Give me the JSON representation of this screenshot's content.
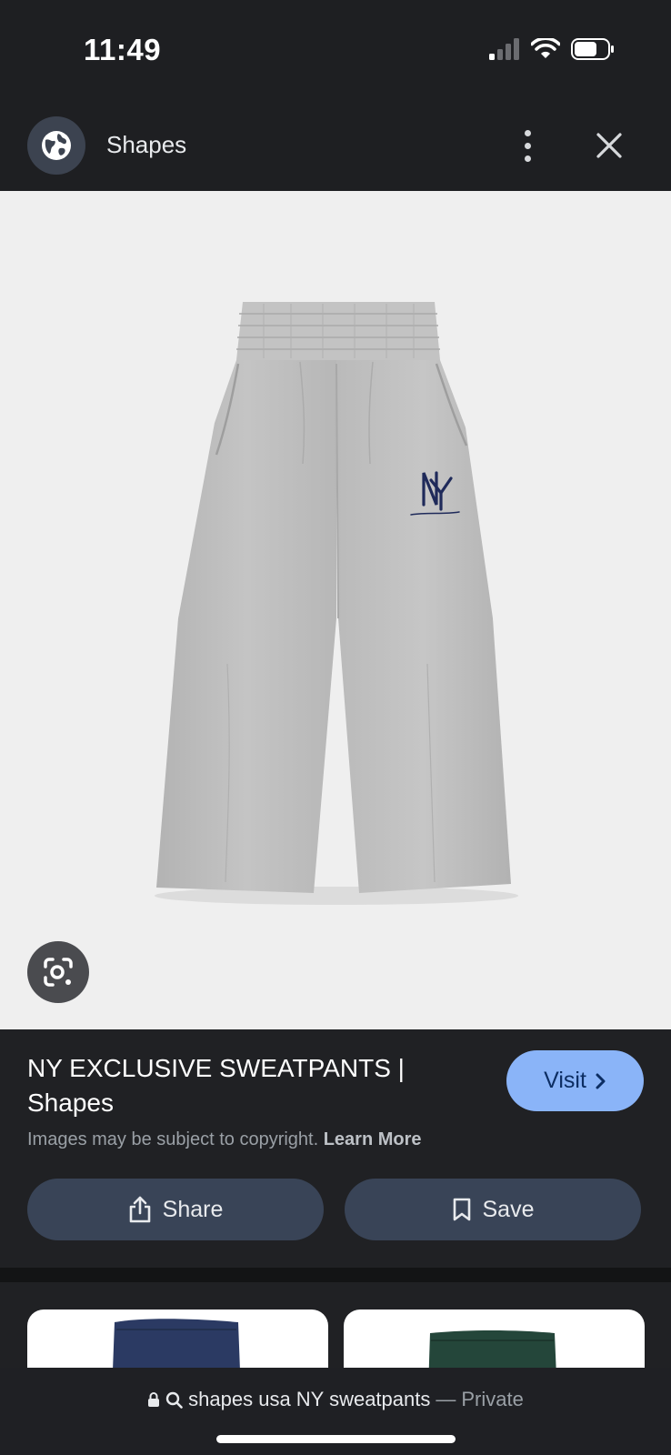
{
  "status_bar": {
    "time": "11:49",
    "icons": [
      "cellular-signal-icon",
      "wifi-icon",
      "battery-icon"
    ]
  },
  "header": {
    "site_icon": "globe-icon",
    "title": "Shapes",
    "menu_icon": "more-vert-icon",
    "close_icon": "close-icon"
  },
  "image": {
    "subject": "grey-sweatpants-ny-logo",
    "lens_icon": "lens-search-icon"
  },
  "info": {
    "title": "NY EXCLUSIVE SWEATPANTS | Shapes",
    "visit_label": "Visit",
    "copyright_text": "Images may be subject to copyright.",
    "learn_more_label": "Learn More",
    "share_label": "Share",
    "save_label": "Save"
  },
  "related": {
    "items": [
      {
        "name": "navy-sweatpants",
        "color": "#2b3a63"
      },
      {
        "name": "green-sweatpants",
        "color": "#24463a"
      }
    ]
  },
  "url_bar": {
    "query": "shapes usa NY sweatpants",
    "separator": "—",
    "privacy": "Private"
  },
  "colors": {
    "accent": "#8ab4f8",
    "panel_bg": "#202124",
    "button_bg": "#394457"
  }
}
